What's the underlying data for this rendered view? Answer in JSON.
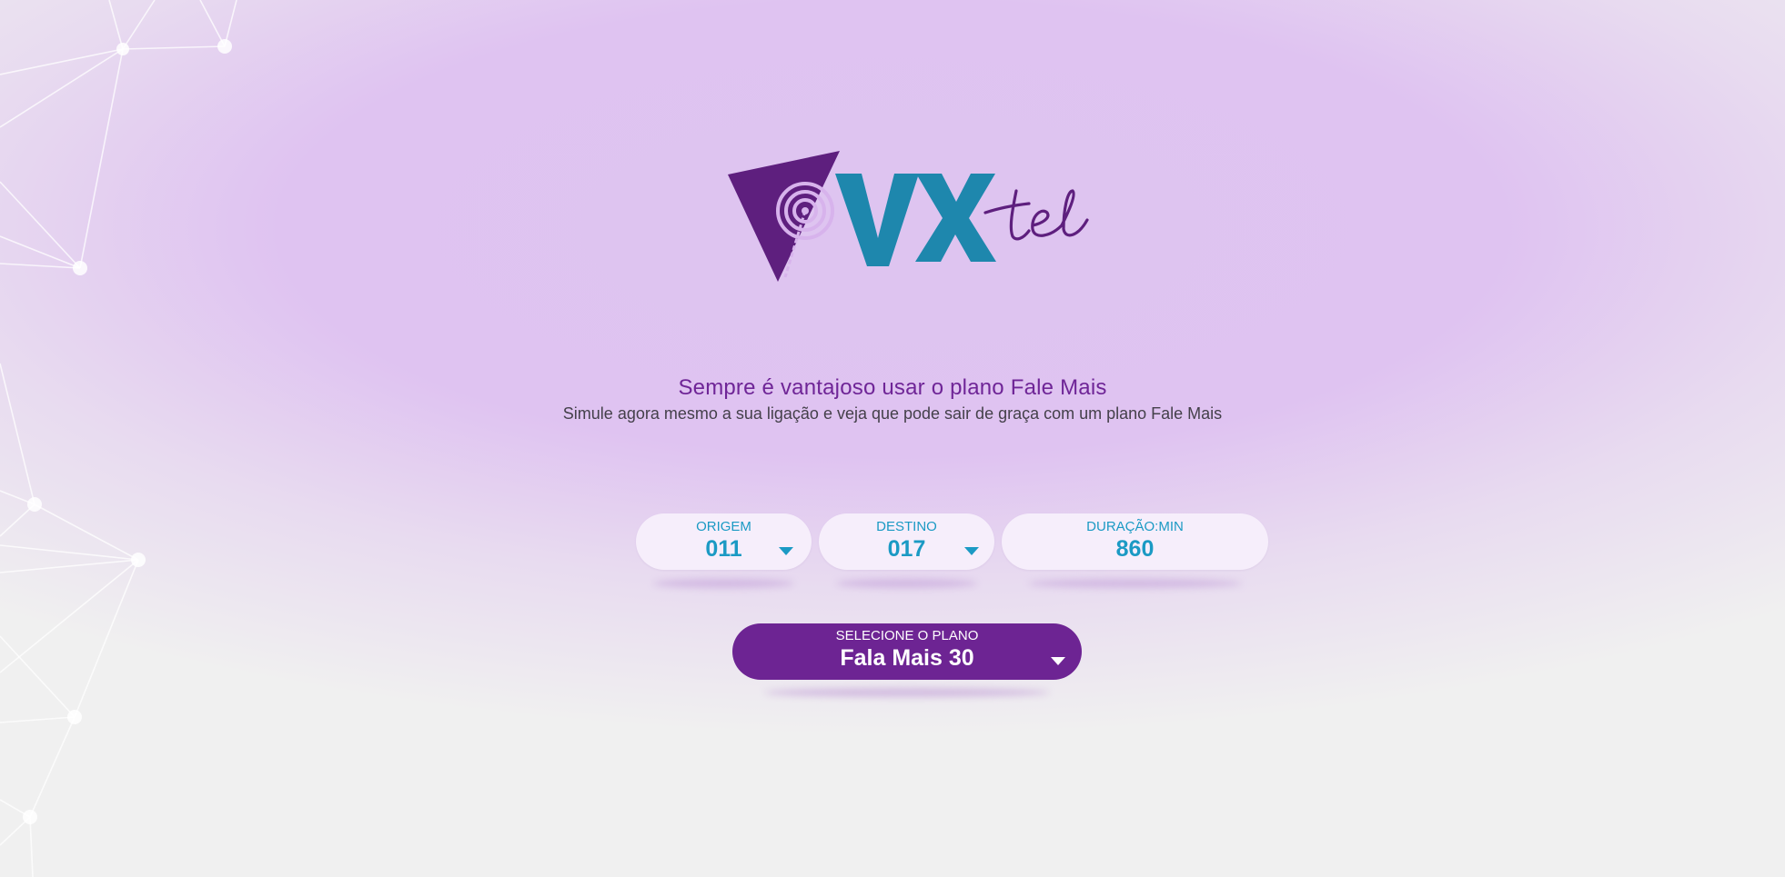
{
  "brand": {
    "logo_letters": "VX",
    "logo_script": "tel",
    "colors": {
      "purple": "#6d2493",
      "blue": "#1b9ac4",
      "light_purple_bg": "#dfc3f1",
      "field_bg": "#f6eefb"
    }
  },
  "hero": {
    "headline": "Sempre é vantajoso usar o plano Fale Mais",
    "subline": "Simule agora mesmo a sua ligação e veja que pode sair de graça com um plano Fale Mais"
  },
  "form": {
    "origem": {
      "label": "ORIGEM",
      "value": "011",
      "icon": "caret-down-icon"
    },
    "destino": {
      "label": "DESTINO",
      "value": "017",
      "icon": "caret-down-icon"
    },
    "duracao": {
      "label": "DURAÇÃO:MIN",
      "value": "860"
    },
    "plano": {
      "label": "SELECIONE O PLANO",
      "value": "Fala Mais 30",
      "icon": "caret-down-icon"
    }
  }
}
